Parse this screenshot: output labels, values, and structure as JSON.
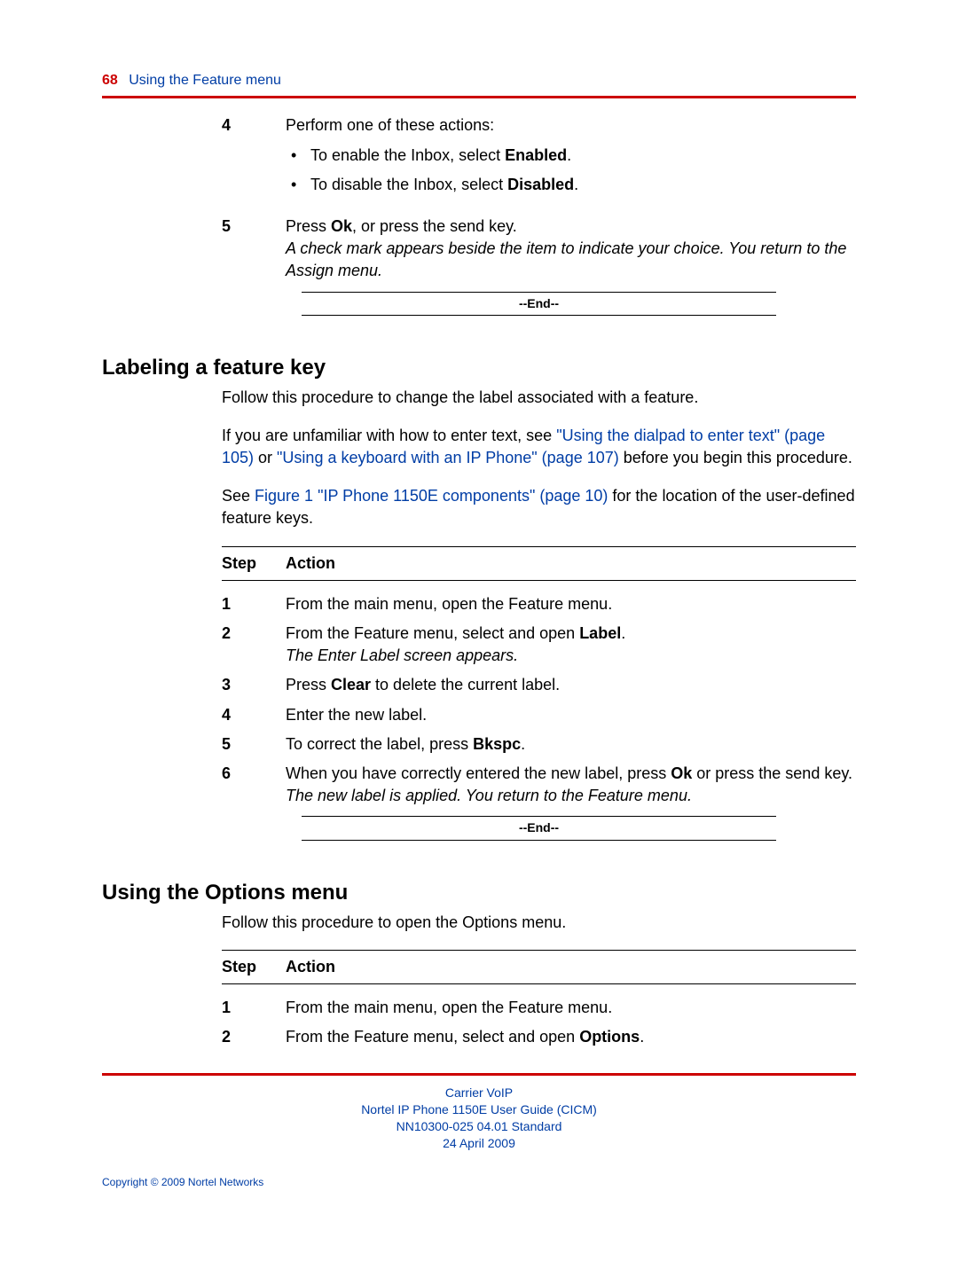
{
  "header": {
    "page_number": "68",
    "section_title": "Using the Feature menu"
  },
  "block1": {
    "step4": {
      "num": "4",
      "intro": "Perform one of these actions:",
      "b1a": "To enable the Inbox, select ",
      "b1b": "Enabled",
      "b1c": ".",
      "b2a": "To disable the Inbox, select ",
      "b2b": "Disabled",
      "b2c": "."
    },
    "step5": {
      "num": "5",
      "l1a": "Press ",
      "l1b": "Ok",
      "l1c": ", or press the send key.",
      "l2": "A check mark appears beside the item to indicate your choice. You return to the Assign menu."
    },
    "end": "--End--"
  },
  "section_labeling": {
    "heading": "Labeling a feature key",
    "p1": "Follow this procedure to change the label associated with a feature.",
    "p2a": "If you are unfamiliar with how to enter text, see ",
    "p2link1": "\"Using the dialpad to enter text\" (page 105)",
    "p2b": " or ",
    "p2link2": "\"Using a keyboard with an IP Phone\" (page 107)",
    "p2c": " before you begin this procedure.",
    "p3a": "See ",
    "p3link": "Figure 1 \"IP Phone 1150E components\" (page 10)",
    "p3b": " for the location of the user-defined feature keys.",
    "head_step": "Step",
    "head_action": "Action",
    "s1": {
      "num": "1",
      "t": "From the main menu, open the Feature menu."
    },
    "s2": {
      "num": "2",
      "t1a": "From the Feature menu, select and open ",
      "t1b": "Label",
      "t1c": ".",
      "t2": "The Enter Label screen appears."
    },
    "s3": {
      "num": "3",
      "t1a": "Press ",
      "t1b": "Clear",
      "t1c": " to delete the current label."
    },
    "s4": {
      "num": "4",
      "t": "Enter the new label."
    },
    "s5": {
      "num": "5",
      "t1a": "To correct the label, press ",
      "t1b": "Bkspc",
      "t1c": "."
    },
    "s6": {
      "num": "6",
      "t1a": "When you have correctly entered the new label, press ",
      "t1b": "Ok",
      "t1c": " or press the send key.",
      "t2": "The new label is applied. You return to the Feature menu."
    },
    "end": "--End--"
  },
  "section_options": {
    "heading": "Using the Options menu",
    "p1": "Follow this procedure to open the Options menu.",
    "head_step": "Step",
    "head_action": "Action",
    "s1": {
      "num": "1",
      "t": "From the main menu, open the Feature menu."
    },
    "s2": {
      "num": "2",
      "t1a": "From the Feature menu, select and open ",
      "t1b": "Options",
      "t1c": "."
    }
  },
  "footer": {
    "l1": "Carrier VoIP",
    "l2": "Nortel IP Phone 1150E User Guide (CICM)",
    "l3": "NN10300-025   04.01   Standard",
    "l4": "24 April 2009",
    "copyright": "Copyright © 2009 Nortel Networks"
  }
}
